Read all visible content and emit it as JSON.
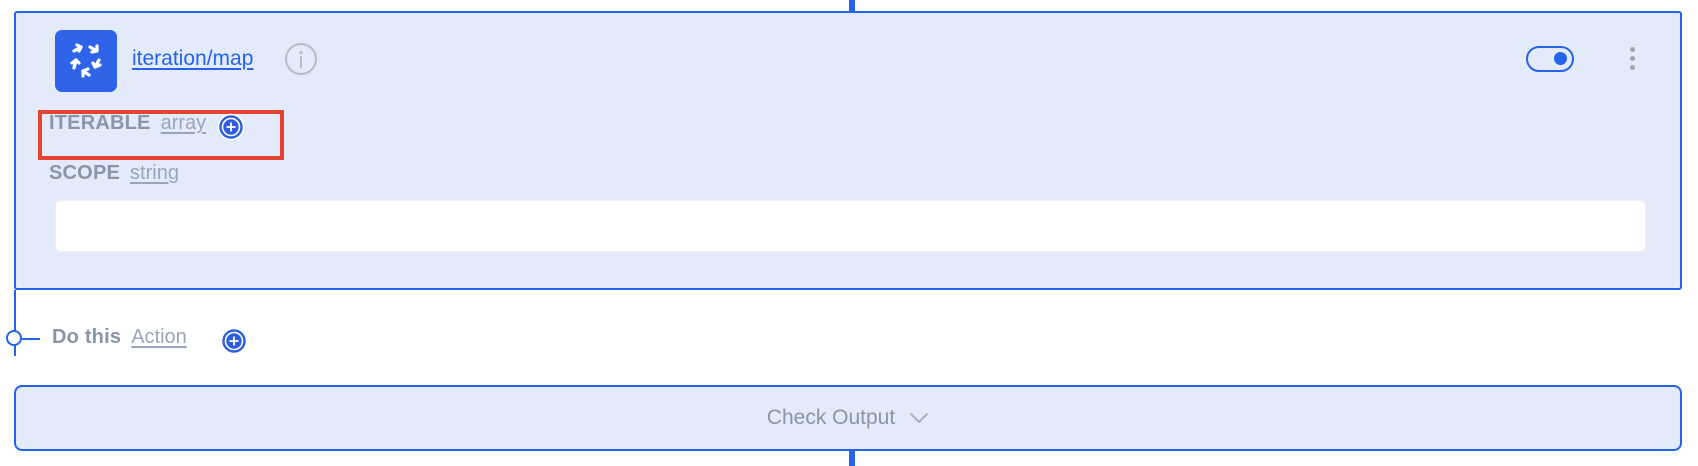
{
  "node": {
    "icon": "iteration-cycle-icon",
    "title": "iteration/map",
    "info_icon": "info-icon",
    "toggle": {
      "enabled": true
    },
    "menu_icon": "kebab-menu-icon"
  },
  "fields": [
    {
      "label": "ITERABLE",
      "type": "array",
      "action_icon": "plus-circle-icon",
      "highlighted": true,
      "highlight_color": "#e5432d"
    },
    {
      "label": "SCOPE",
      "type": "string",
      "input_value": ""
    }
  ],
  "branch": {
    "label": "Do this",
    "type": "Action",
    "action_icon": "plus-circle-icon"
  },
  "check_output": {
    "label": "Check Output",
    "icon": "chevron-down-icon"
  },
  "colors": {
    "accent": "#2563eb",
    "card_bg": "#e3ebfa",
    "muted_text": "#8a94ab"
  }
}
